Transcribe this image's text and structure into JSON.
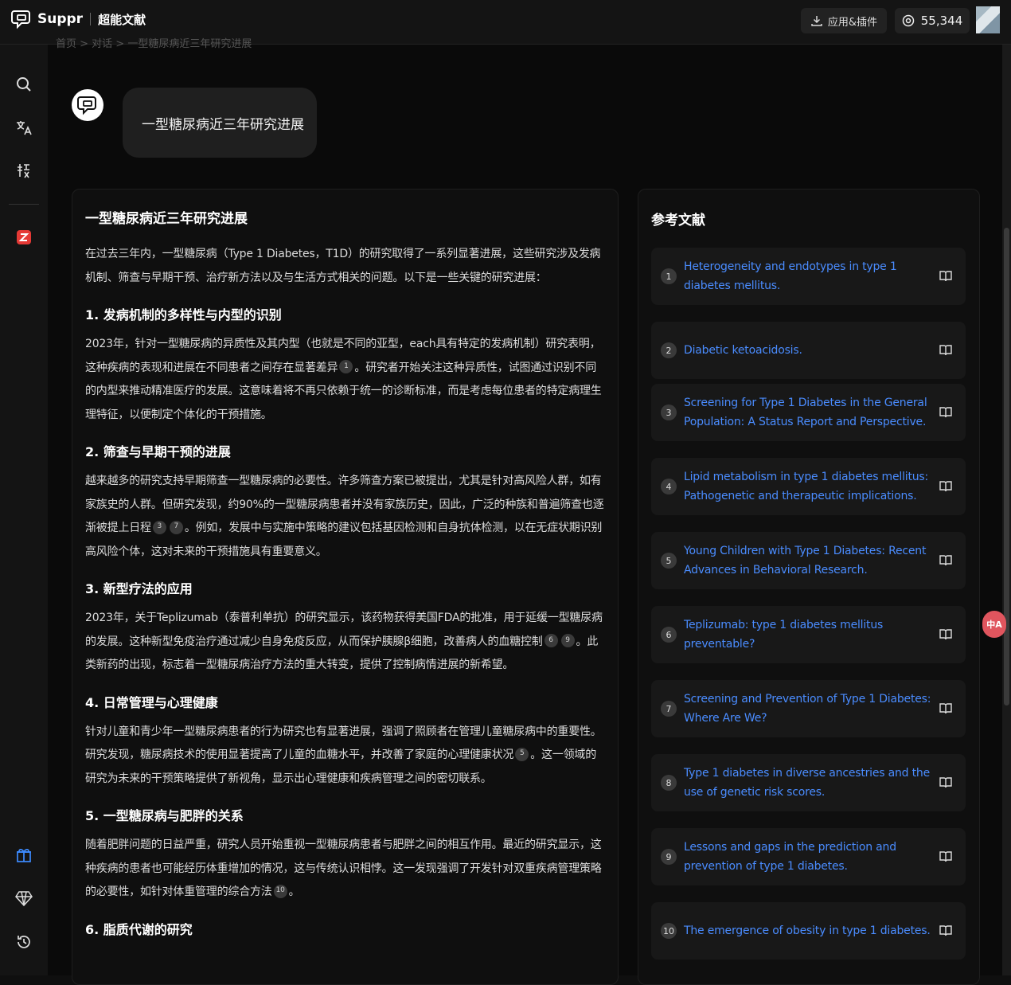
{
  "header": {
    "brand": "Suppr",
    "product": "超能文献",
    "apps_label": "应用&插件",
    "credits": "55,344"
  },
  "breadcrumb_faded": "首页 > 对话 > 一型糖尿病近三年研究进展",
  "question": "一型糖尿病近三年研究进展",
  "answer": {
    "title": "一型糖尿病近三年研究进展",
    "intro": "在过去三年内，一型糖尿病（Type 1 Diabetes，T1D）的研究取得了一系列显著进展，这些研究涉及发病机制、筛查与早期干预、治疗新方法以及与生活方式相关的问题。以下是一些关键的研究进展：",
    "s1_heading": "1. 发病机制的多样性与内型的识别",
    "s1_a": "2023年，针对一型糖尿病的异质性及其内型（也就是不同的亚型，each具有特定的发病机制）研究表明，这种疾病的表现和进展在不同患者之间存在显著差异",
    "s1_c1": "1",
    "s1_b": "。研究者开始关注这种异质性，试图通过识别不同的内型来推动精准医疗的发展。这意味着将不再只依赖于统一的诊断标准，而是考虑每位患者的特定病理生理特征，以便制定个体化的干预措施。",
    "s2_heading": "2. 筛查与早期干预的进展",
    "s2_a": "越来越多的研究支持早期筛查一型糖尿病的必要性。许多筛查方案已被提出，尤其是针对高风险人群，如有家族史的人群。但研究发现，约90%的一型糖尿病患者并没有家族历史，因此，广泛的种族和普遍筛查也逐渐被提上日程",
    "s2_c1": "3",
    "s2_c2": "7",
    "s2_b": "。例如，发展中与实施中策略的建议包括基因检测和自身抗体检测，以在无症状期识别高风险个体，这对未来的干预措施具有重要意义。",
    "s3_heading": "3. 新型疗法的应用",
    "s3_a": "2023年，关于Teplizumab（泰普利单抗）的研究显示，该药物获得美国FDA的批准，用于延缓一型糖尿病的发展。这种新型免疫治疗通过减少自身免疫反应，从而保护胰腺β细胞，改善病人的血糖控制",
    "s3_c1": "6",
    "s3_c2": "9",
    "s3_b": "。此类新药的出现，标志着一型糖尿病治疗方法的重大转变，提供了控制病情进展的新希望。",
    "s4_heading": "4. 日常管理与心理健康",
    "s4_a": "针对儿童和青少年一型糖尿病患者的行为研究也有显著进展，强调了照顾者在管理儿童糖尿病中的重要性。研究发现，糖尿病技术的使用显著提高了儿童的血糖水平，并改善了家庭的心理健康状况",
    "s4_c1": "5",
    "s4_b": "。这一领域的研究为未来的干预策略提供了新视角，显示出心理健康和疾病管理之间的密切联系。",
    "s5_heading": "5. 一型糖尿病与肥胖的关系",
    "s5_a": "随着肥胖问题的日益严重，研究人员开始重视一型糖尿病患者与肥胖之间的相互作用。最近的研究显示，这种疾病的患者也可能经历体重增加的情况，这与传统认识相悖。这一发现强调了开发针对双重疾病管理策略的必要性，如针对体重管理的综合方法",
    "s5_c1": "10",
    "s5_b": "。",
    "s6_heading": "6. 脂质代谢的研究"
  },
  "references": {
    "title": "参考文献",
    "items": [
      {
        "num": "1",
        "title": "Heterogeneity and endotypes in type 1 diabetes mellitus."
      },
      {
        "num": "2",
        "title": "Diabetic ketoacidosis."
      },
      {
        "num": "3",
        "title": "Screening for Type 1 Diabetes in the General Population: A Status Report and Perspective."
      },
      {
        "num": "4",
        "title": "Lipid metabolism in type 1 diabetes mellitus: Pathogenetic and therapeutic implications."
      },
      {
        "num": "5",
        "title": "Young Children with Type 1 Diabetes: Recent Advances in Behavioral Research."
      },
      {
        "num": "6",
        "title": "Teplizumab: type 1 diabetes mellitus preventable?"
      },
      {
        "num": "7",
        "title": "Screening and Prevention of Type 1 Diabetes: Where Are We?"
      },
      {
        "num": "8",
        "title": "Type 1 diabetes in diverse ancestries and the use of genetic risk scores."
      },
      {
        "num": "9",
        "title": "Lessons and gaps in the prediction and prevention of type 1 diabetes."
      },
      {
        "num": "10",
        "title": "The emergence of obesity in type 1 diabetes."
      }
    ]
  },
  "translate_fab": "中A",
  "colors": {
    "link": "#4a8cff",
    "fab": "#e0555e",
    "bg": "#0a0a0a"
  }
}
